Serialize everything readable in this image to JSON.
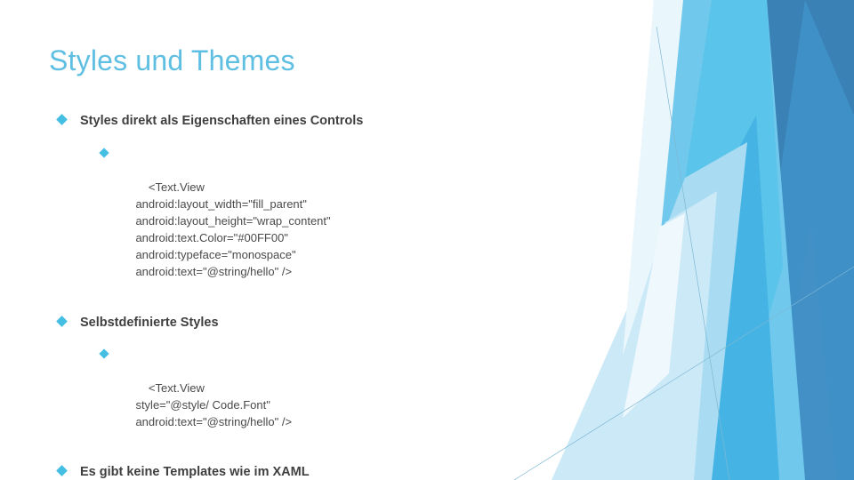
{
  "slide": {
    "title": "Styles und Themes",
    "accent_color": "#5FBFE2",
    "bullet_color": "#45BEE3",
    "body_text_color": "#3F3F3F",
    "background_color": "#FFFFFF"
  },
  "bullets": {
    "item1_label": "Styles direkt als Eigenschaften eines Controls",
    "item1_code": "<Text.View\n    android:layout_width=\"fill_parent\"\n    android:layout_height=\"wrap_content\"\n    android:text.Color=\"#00FF00\"\n    android:typeface=\"monospace\"\n    android:text=\"@string/hello\" />",
    "item2_label": "Selbstdefinierte Styles",
    "item2_code": "<Text.View\n    style=\"@style/ Code.Font\"\n    android:text=\"@string/hello\" />",
    "item3_label": "Es gibt keine Templates wie im XAML"
  },
  "decoration": {
    "name": "facet-angled-shapes",
    "colors": {
      "pale_1": "#E9F6FC",
      "pale_2": "#CCE9F7",
      "pale_3": "#A9DCF2",
      "light_blue": "#70C8EC",
      "sky_blue": "#5BC4EA",
      "cyan": "#22A3DC",
      "mid_blue": "#4090C8",
      "steel_blue": "#3A81B5",
      "dark_blue": "#2E79AB",
      "hairline": "#7FB8D4"
    }
  }
}
